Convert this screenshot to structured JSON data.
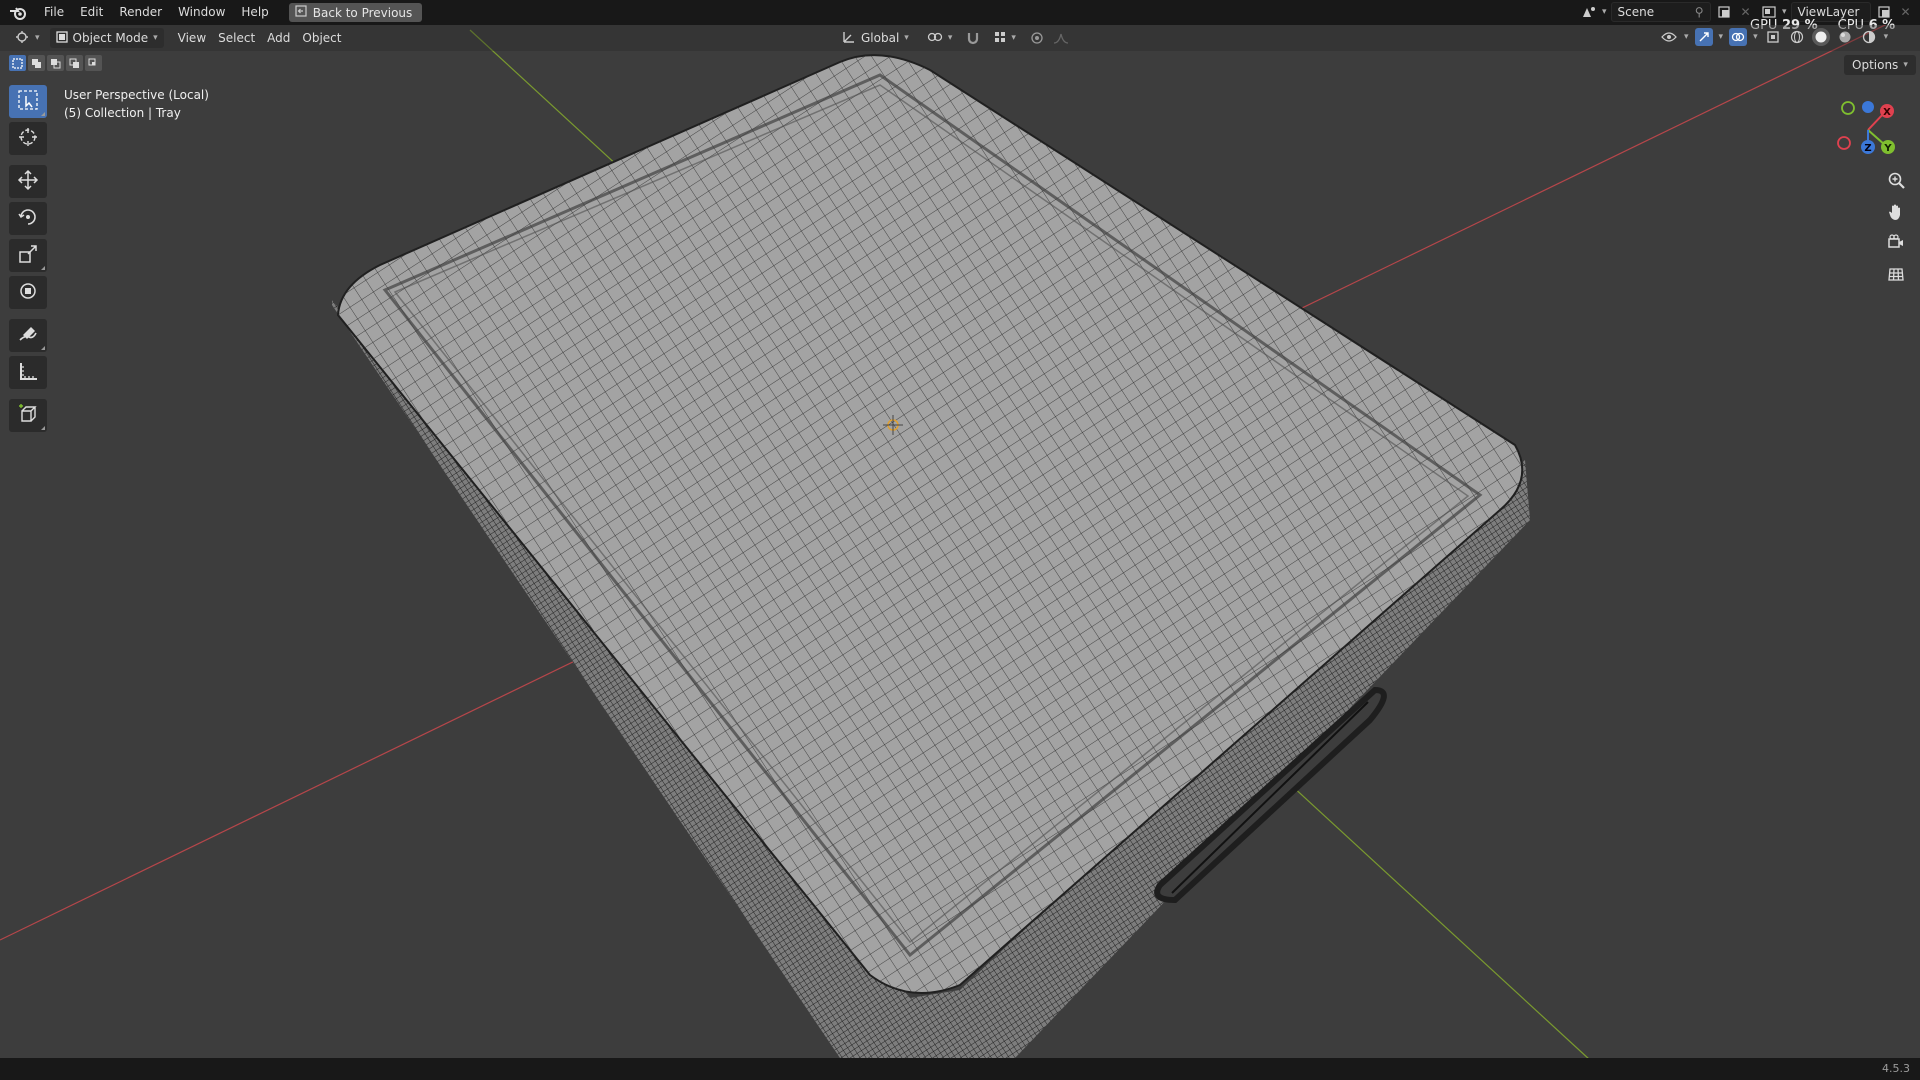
{
  "topbar": {
    "menu": [
      "File",
      "Edit",
      "Render",
      "Window",
      "Help"
    ],
    "back_button": "Back to Previous",
    "scene": "Scene",
    "view_layer": "ViewLayer",
    "gpu_label": "GPU",
    "gpu_value": "29 %",
    "cpu_label": "CPU",
    "cpu_value": "6 %"
  },
  "header": {
    "mode": "Object Mode",
    "menus": [
      "View",
      "Select",
      "Add",
      "Object"
    ],
    "orientation": "Global",
    "options": "Options"
  },
  "viewport": {
    "perspective": "User Perspective (Local)",
    "collection": "(5) Collection | Tray",
    "background_color": "#3d3d3d",
    "axis_x_color": "#b5464a",
    "axis_y_color": "#7a9a2f"
  },
  "gizmo": {
    "x_label": "X",
    "y_label": "Y",
    "z_label": "Z",
    "x_color": "#e0414f",
    "y_color": "#7fbf2f",
    "z_color": "#3b78d8"
  },
  "toolbar_icons": [
    "select-box-icon",
    "cursor-icon",
    "move-icon",
    "rotate-icon",
    "scale-icon",
    "transform-icon",
    "annotate-icon",
    "measure-icon",
    "add-cube-icon"
  ],
  "status": {
    "version": "4.5.3"
  }
}
